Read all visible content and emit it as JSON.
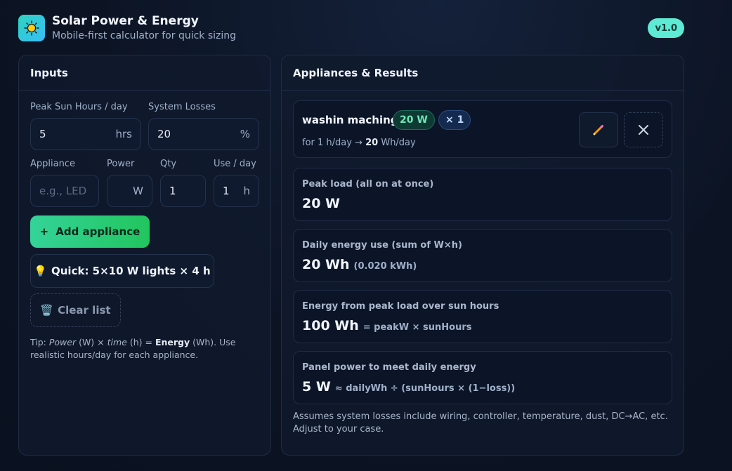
{
  "header": {
    "title": "Solar Power & Energy",
    "subtitle": "Mobile-first calculator for quick sizing",
    "version": "v1.0",
    "logo_icon": "sun-icon"
  },
  "inputs": {
    "heading": "Inputs",
    "sun_hours": {
      "label": "Peak Sun Hours / day",
      "value": "5",
      "unit": "hrs"
    },
    "losses": {
      "label": "System Losses",
      "value": "20",
      "unit": "%"
    },
    "appliance": {
      "label": "Appliance",
      "placeholder": "e.g., LED B"
    },
    "power": {
      "label": "Power",
      "value": "",
      "unit": "W"
    },
    "qty": {
      "label": "Qty",
      "value": "1"
    },
    "use": {
      "label": "Use / day",
      "value": "1",
      "unit": "h"
    },
    "add_button": {
      "icon": "+",
      "label": "Add appliance"
    },
    "quick_button": {
      "icon": "💡",
      "label": "Quick: 5×10 W lights × 4 h"
    },
    "clear_button": {
      "icon": "🗑️",
      "label": "Clear list"
    },
    "tip": {
      "prefix": "Tip: ",
      "power_word": "Power",
      "power_unit": " (W) × ",
      "time_word": "time",
      "time_unit": " (h) = ",
      "energy_word": "Energy",
      "suffix": " (Wh). Use realistic hours/day for each appliance."
    }
  },
  "results": {
    "heading": "Appliances & Results",
    "appliance": {
      "name": "washin maching",
      "power_badge": "20 W",
      "qty_badge": "× 1",
      "meta_prefix": "for 1 h/day → ",
      "meta_energy": "20",
      "meta_suffix": " Wh/day",
      "edit_icon": "pencil-icon",
      "delete_icon": "close-icon"
    },
    "peak": {
      "label": "Peak load (all on at once)",
      "value": "20 W"
    },
    "daily": {
      "label": "Daily energy use (sum of W×h)",
      "value": "20 Wh",
      "extra": "(0.020 kWh)"
    },
    "sun_energy": {
      "label": "Energy from peak load over sun hours",
      "value": "100 Wh",
      "extra": "= peakW × sunHours"
    },
    "panel": {
      "label": "Panel power to meet daily energy",
      "value": "5 W",
      "extra": "≈ dailyWh ÷ (sunHours × (1−loss))"
    },
    "note": "Assumes system losses include wiring, controller, temperature, dust, DC→AC, etc. Adjust to your case."
  },
  "colors": {
    "accent_green": "#22c55e",
    "accent_teal": "#5eead4",
    "background": "#0c1424",
    "panel": "#111a2d"
  }
}
